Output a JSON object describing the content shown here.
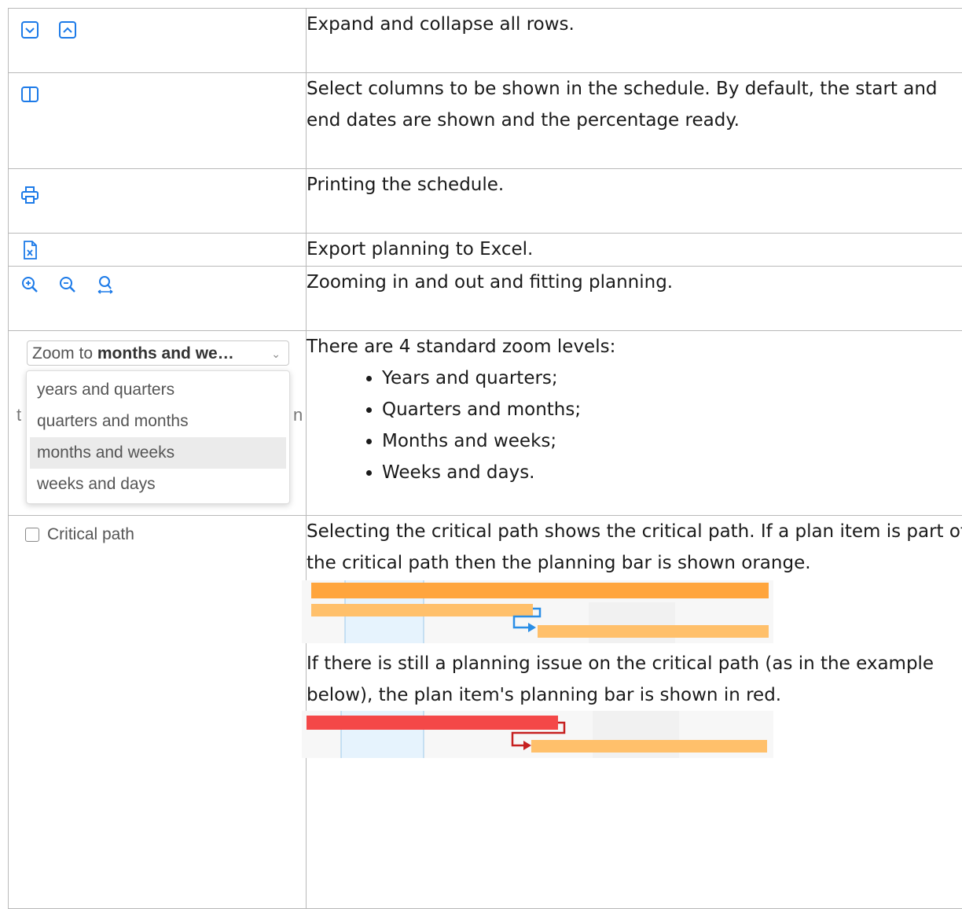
{
  "rows": [
    {
      "icons": [
        "expand-all-icon",
        "collapse-all-icon"
      ],
      "text": "Expand and collapse all rows."
    },
    {
      "icons": [
        "columns-icon"
      ],
      "text": "Select columns to be shown in the schedule. By default, the start and end dates are shown and the percentage ready."
    },
    {
      "icons": [
        "print-icon"
      ],
      "text": "Printing the schedule."
    },
    {
      "icons": [
        "excel-export-icon"
      ],
      "text": "Export planning to Excel."
    },
    {
      "icons": [
        "zoom-in-icon",
        "zoom-out-icon",
        "zoom-fit-icon"
      ],
      "text": "Zooming in and out and fitting planning."
    },
    {
      "intro": "There are 4 standard zoom levels:",
      "items": [
        "Years and quarters;",
        "Quarters and months;",
        "Months and weeks;",
        "Weeks and days."
      ],
      "dropdown": {
        "prefix": "Zoom to",
        "selected": "months and we…",
        "options": [
          "years and quarters",
          "quarters and months",
          "months and weeks",
          "weeks and days"
        ],
        "highlighted": "months and weeks"
      }
    },
    {
      "checkbox_label": "Critical path",
      "text1": "Selecting the critical path shows the critical path. If a plan item is part of the critical path then the planning bar is shown orange.",
      "text2": "If there is still a planning issue on the critical path (as in the example below), the plan item's planning bar is shown in red."
    }
  ],
  "colors": {
    "icon_blue": "#1c7ae8",
    "critical_orange": "#ffa53d",
    "normal_bar": "#ffc06b",
    "issue_red": "#f44848",
    "link_blue": "#2a8ee6",
    "link_red": "#c62020"
  }
}
